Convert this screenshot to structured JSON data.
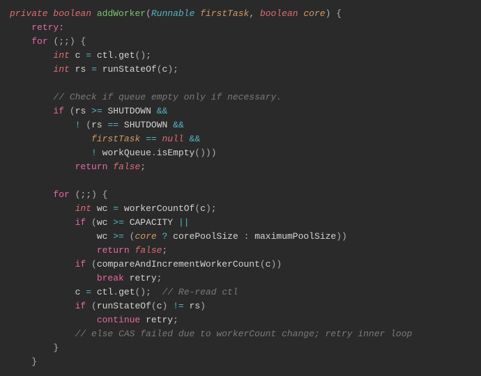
{
  "tokens": {
    "l1": {
      "private": "private",
      "boolean": "boolean",
      "method": "addWorker",
      "type1": "Runnable",
      "param1": "firstTask",
      "boolean2": "boolean",
      "param2": "core"
    },
    "l2": {
      "kw": "retry"
    },
    "l3": {
      "for": "for"
    },
    "l4": {
      "int": "int",
      "var": "c",
      "fn": "ctl",
      "call": "get"
    },
    "l5": {
      "int": "int",
      "var": "rs",
      "fn": "runStateOf",
      "arg": "c"
    },
    "l7": {
      "comment": "// Check if queue empty only if necessary."
    },
    "l8": {
      "if": "if",
      "var": "rs",
      "const": "SHUTDOWN"
    },
    "l9": {
      "var": "rs",
      "const": "SHUTDOWN"
    },
    "l10": {
      "var": "firstTask",
      "null": "null"
    },
    "l11": {
      "obj": "workQueue",
      "fn": "isEmpty"
    },
    "l12": {
      "return": "return",
      "false": "false"
    },
    "l14": {
      "for": "for"
    },
    "l15": {
      "int": "int",
      "var": "wc",
      "fn": "workerCountOf",
      "arg": "c"
    },
    "l16": {
      "if": "if",
      "var": "wc",
      "const": "CAPACITY"
    },
    "l17": {
      "var": "wc",
      "core": "core",
      "a": "corePoolSize",
      "b": "maximumPoolSize"
    },
    "l18": {
      "return": "return",
      "false": "false"
    },
    "l19": {
      "if": "if",
      "fn": "compareAndIncrementWorkerCount",
      "arg": "c"
    },
    "l20": {
      "break": "break",
      "label": "retry"
    },
    "l21": {
      "var": "c",
      "obj": "ctl",
      "fn": "get",
      "comment": "// Re-read ctl"
    },
    "l22": {
      "if": "if",
      "fn": "runStateOf",
      "arg": "c",
      "var": "rs"
    },
    "l23": {
      "continue": "continue",
      "label": "retry"
    },
    "l24": {
      "comment": "// else CAS failed due to workerCount change; retry inner loop"
    }
  }
}
